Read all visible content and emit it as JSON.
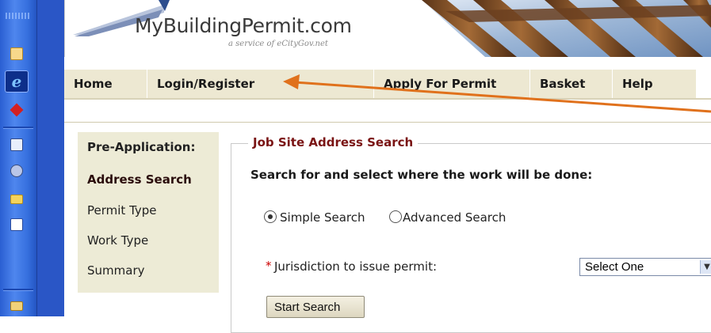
{
  "header": {
    "logo_text": "MyBuildingPermit.com",
    "tagline": "a service of eCityGov.net"
  },
  "nav": {
    "tabs": [
      {
        "label": "Home"
      },
      {
        "label": "Login/Register"
      },
      {
        "label": "Apply For Permit"
      },
      {
        "label": "Basket"
      },
      {
        "label": "Help"
      }
    ]
  },
  "sidebar": {
    "title": "Pre-Application:",
    "steps": [
      {
        "label": "Address Search",
        "active": true
      },
      {
        "label": "Permit Type"
      },
      {
        "label": "Work Type"
      },
      {
        "label": "Summary"
      }
    ]
  },
  "search": {
    "legend": "Job Site Address Search",
    "instructions": "Search for and select where the work will be done:",
    "simple_label": "Simple Search",
    "advanced_label": "Advanced Search",
    "selected_mode": "Simple Search",
    "required_mark": "*",
    "jurisdiction_label": "Jurisdiction to issue permit:",
    "jurisdiction_value": "Select One",
    "start_button": "Start Search"
  },
  "colors": {
    "nav_tab_bg": "#ede8d2",
    "legend_text": "#7a1414",
    "annotation_arrow": "#e0711c",
    "taskbar_blue": "#2a56c6"
  },
  "quicklaunch": {
    "icons": [
      "outlook-icon",
      "internet-explorer-icon",
      "red-diamond-app-icon",
      "book-icon",
      "network-icon",
      "folder-icon",
      "word-icon",
      "mail-envelope-icon"
    ]
  }
}
